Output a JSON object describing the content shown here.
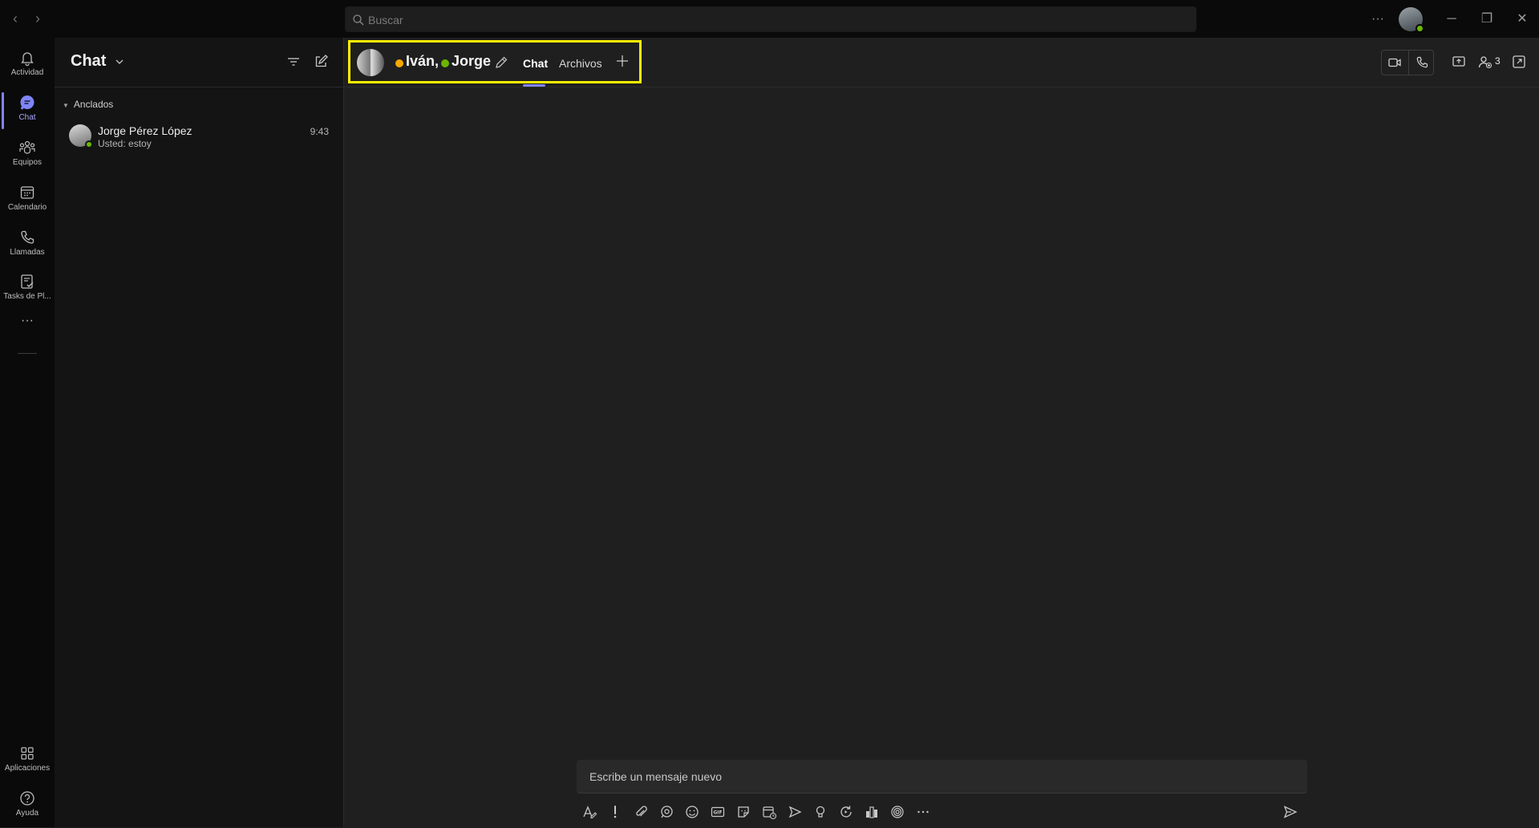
{
  "titlebar": {
    "search_placeholder": "Buscar",
    "more": "···"
  },
  "rail": {
    "items": [
      {
        "label": "Actividad",
        "icon": "bell-icon"
      },
      {
        "label": "Chat",
        "icon": "chat-icon"
      },
      {
        "label": "Equipos",
        "icon": "teams-icon"
      },
      {
        "label": "Calendario",
        "icon": "calendar-icon"
      },
      {
        "label": "Llamadas",
        "icon": "phone-icon"
      },
      {
        "label": "Tasks de Pl...",
        "icon": "tasks-icon"
      }
    ],
    "more": "···",
    "apps_label": "Aplicaciones",
    "help_label": "Ayuda"
  },
  "chat_list": {
    "title": "Chat",
    "section_label": "Anclados",
    "items": [
      {
        "name": "Jorge Pérez López",
        "preview": "Usted: estoy",
        "time": "9:43"
      }
    ]
  },
  "conversation": {
    "members": [
      {
        "name": "Iván,",
        "presence": "away"
      },
      {
        "name": "Jorge",
        "presence": "available"
      }
    ],
    "tabs": [
      {
        "label": "Chat",
        "active": true
      },
      {
        "label": "Archivos",
        "active": false
      }
    ],
    "participant_count": "3",
    "composer_placeholder": "Escribe un mensaje nuevo"
  },
  "colors": {
    "accent": "#7f85f5",
    "available": "#6bb700",
    "away": "#f8a800",
    "highlight": "#fff200"
  }
}
